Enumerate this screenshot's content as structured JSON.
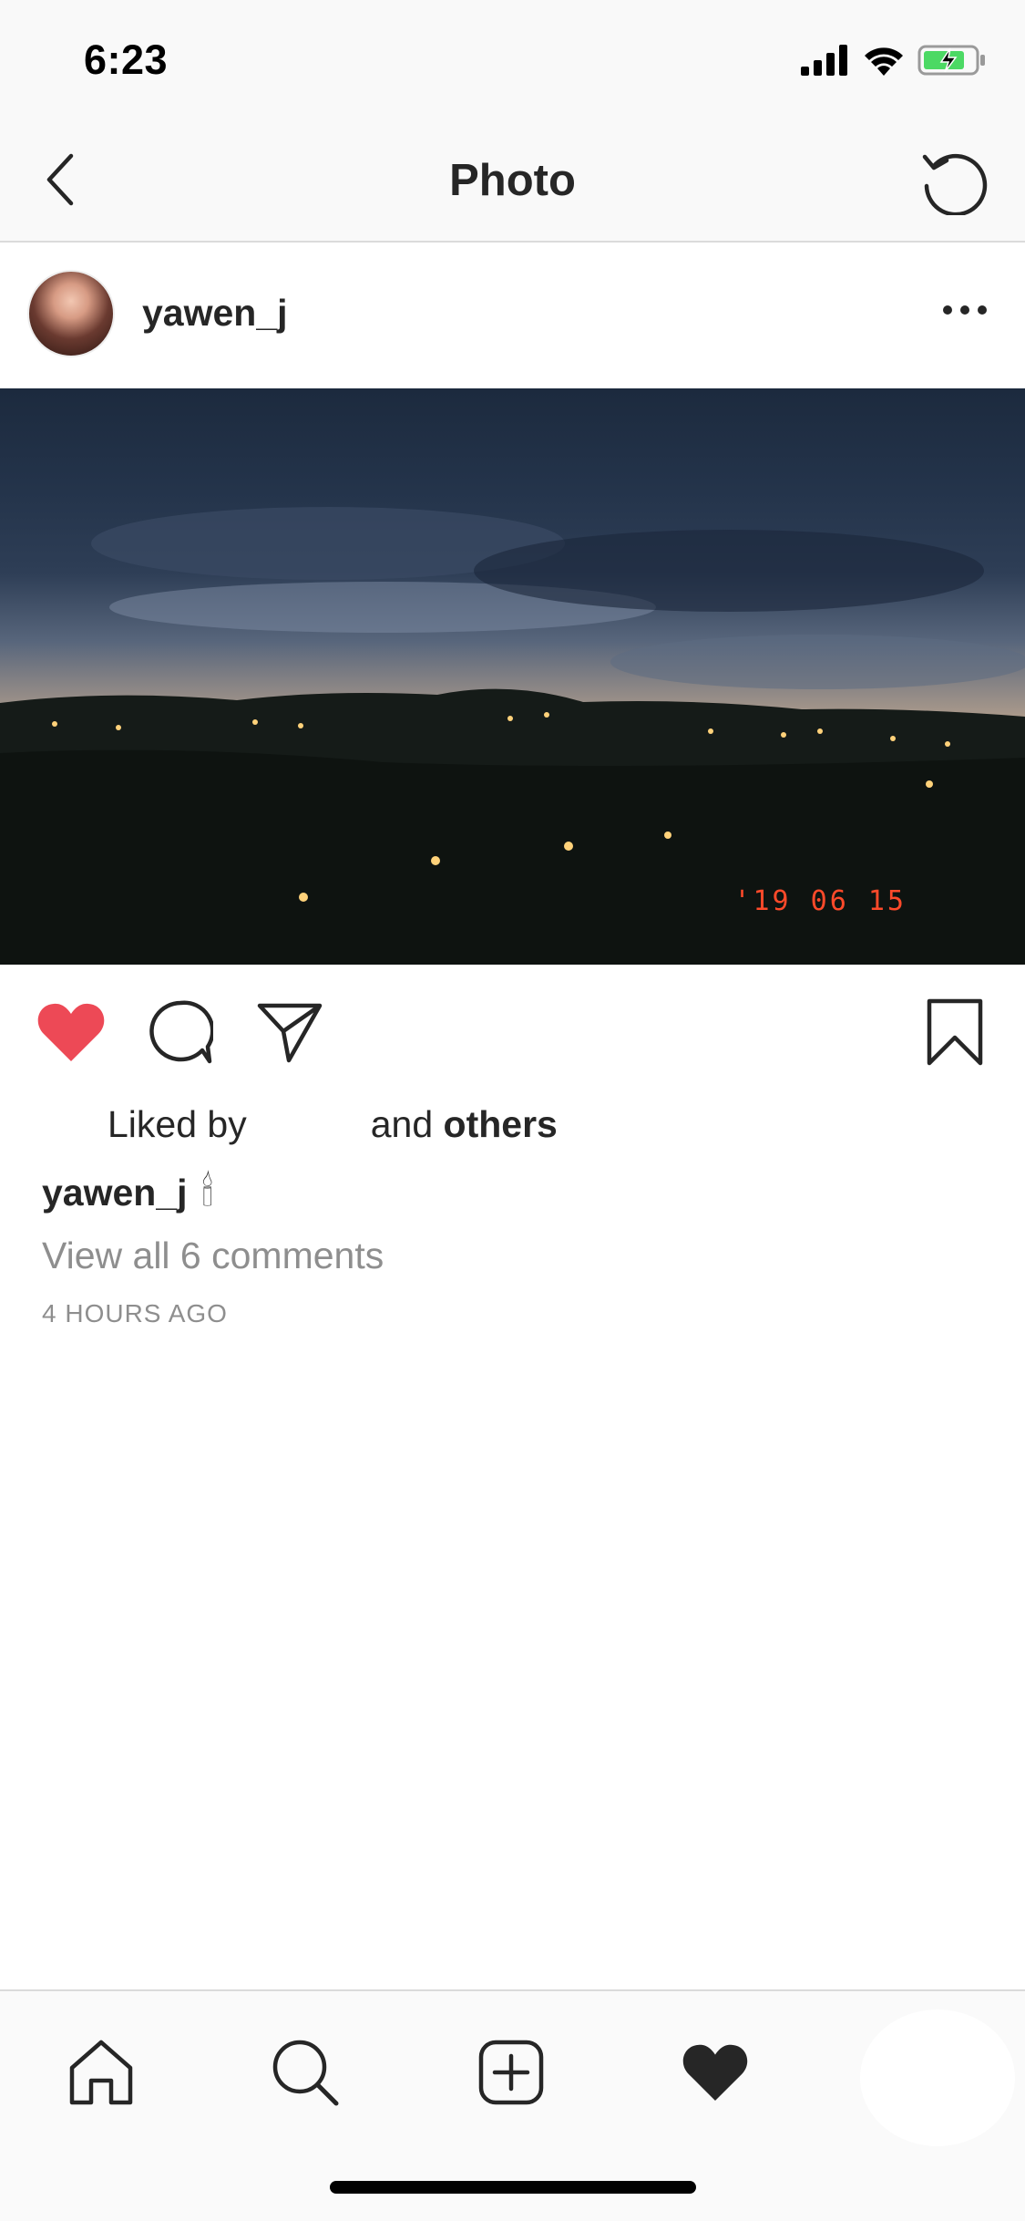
{
  "status_bar": {
    "time": "6:23"
  },
  "nav": {
    "title": "Photo"
  },
  "post": {
    "username": "yawen_j",
    "photo_date_stamp": "'19 06 15",
    "likes": {
      "prefix": "Liked by",
      "middle": "and",
      "suffix": "others"
    },
    "caption_username": "yawen_j",
    "caption_emoji": "🕯",
    "view_comments": "View all 6 comments",
    "time_ago": "4 HOURS AGO"
  },
  "colors": {
    "like_red": "#ed4956",
    "battery_green": "#4cd964",
    "date_stamp": "#ff4a2a"
  },
  "icons": {
    "back": "chevron-left-icon",
    "refresh": "refresh-icon",
    "more": "more-horizontal-icon",
    "like": "heart-filled-icon",
    "comment": "comment-icon",
    "share": "send-icon",
    "save": "bookmark-icon",
    "home": "home-icon",
    "search": "search-icon",
    "add": "add-post-icon",
    "activity": "heart-filled-icon"
  }
}
